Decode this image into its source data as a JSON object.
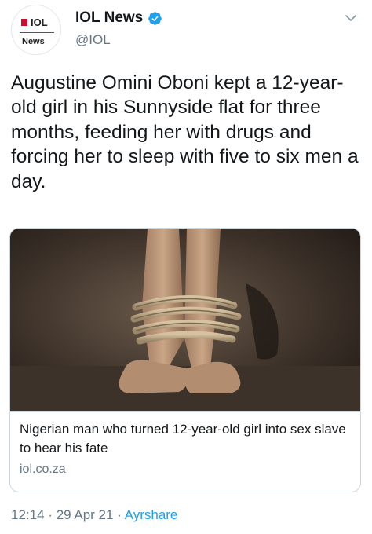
{
  "account": {
    "avatar_line1": "IOL",
    "avatar_line2": "News",
    "display_name": "IOL News",
    "handle": "@IOL",
    "verified": true
  },
  "tweet": {
    "text": "Augustine Omini Oboni kept a 12-year-old girl in his Sunnyside flat for three months, feeding her with drugs and forcing her to sleep with five to six men a day."
  },
  "card": {
    "title": "Nigerian man who turned 12-year-old girl into sex slave to hear his fate",
    "domain": "iol.co.za"
  },
  "meta": {
    "time": "12:14",
    "separator": "·",
    "date": "29 Apr 21",
    "source": "Ayrshare"
  },
  "colors": {
    "link_blue": "#1da1f2",
    "secondary_text": "#657786",
    "avatar_red": "#c8102e"
  },
  "icons": {
    "verified": "verified-badge-icon",
    "menu": "chevron-down-icon"
  }
}
